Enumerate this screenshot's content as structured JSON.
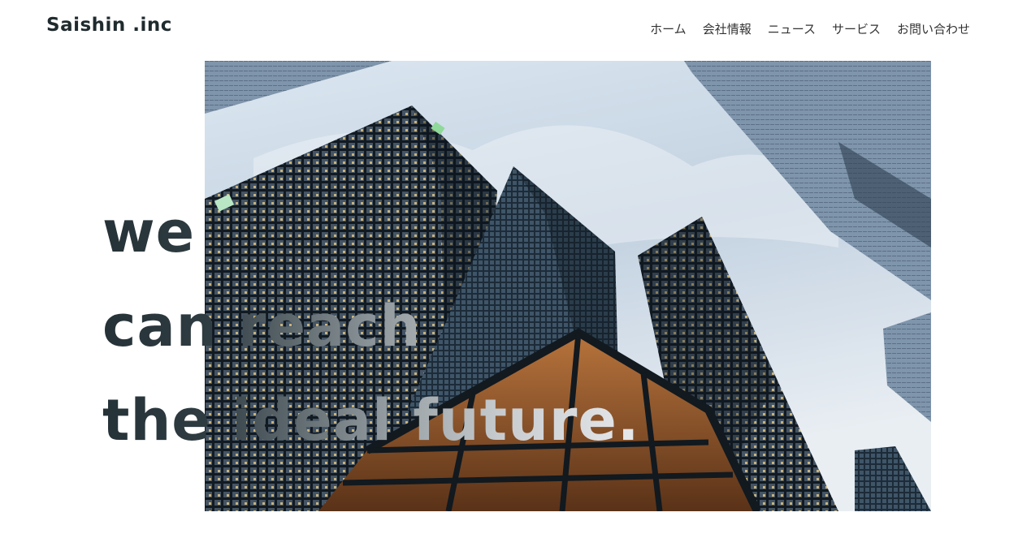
{
  "header": {
    "logo": "Saishin .inc",
    "nav": [
      {
        "label": "ホーム"
      },
      {
        "label": "会社情報"
      },
      {
        "label": "ニュース"
      },
      {
        "label": "サービス"
      },
      {
        "label": "お問い合わせ"
      }
    ]
  },
  "hero": {
    "image": "skyscrapers-photo",
    "headline": [
      "we",
      "can reach",
      "the ideal future."
    ]
  },
  "colors": {
    "text_dark": "#1f2a2e",
    "sky": "#c8d6e4"
  }
}
